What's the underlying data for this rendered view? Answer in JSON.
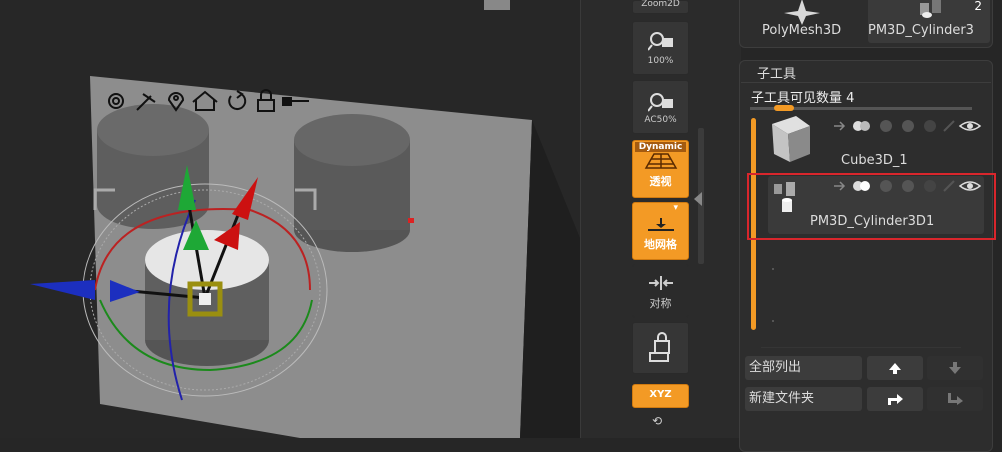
{
  "viewport": {
    "gizmo_tools": [
      "gear-icon",
      "pin-icon",
      "location-icon",
      "home-icon",
      "reset-icon",
      "lock-icon",
      "slider-icon"
    ]
  },
  "shelf": {
    "zoom2d_label": "Zoom2D",
    "zoom100_label": "100%",
    "ac50_label": "AC50%",
    "dynamic_label": "Dynamic",
    "perspective_label": "透视",
    "floor_label": "地网格",
    "symmetry_label": "对称",
    "xyz_label": "XYZ"
  },
  "tool_palette": {
    "tools": [
      {
        "name": "PolyMesh3D"
      },
      {
        "name": "PM3D_Cylinder3",
        "count": "2"
      }
    ]
  },
  "subtool": {
    "title": "子工具",
    "visible_count_label": "子工具可见数量 4",
    "visible_count": 4,
    "items": [
      {
        "name": "Cube3D_1",
        "selected": false
      },
      {
        "name": "PM3D_Cylinder3D1",
        "selected": true
      }
    ],
    "list_all_label": "全部列出",
    "new_folder_label": "新建文件夹"
  },
  "colors": {
    "accent": "#f39a25",
    "highlight_box": "#d9262c"
  }
}
